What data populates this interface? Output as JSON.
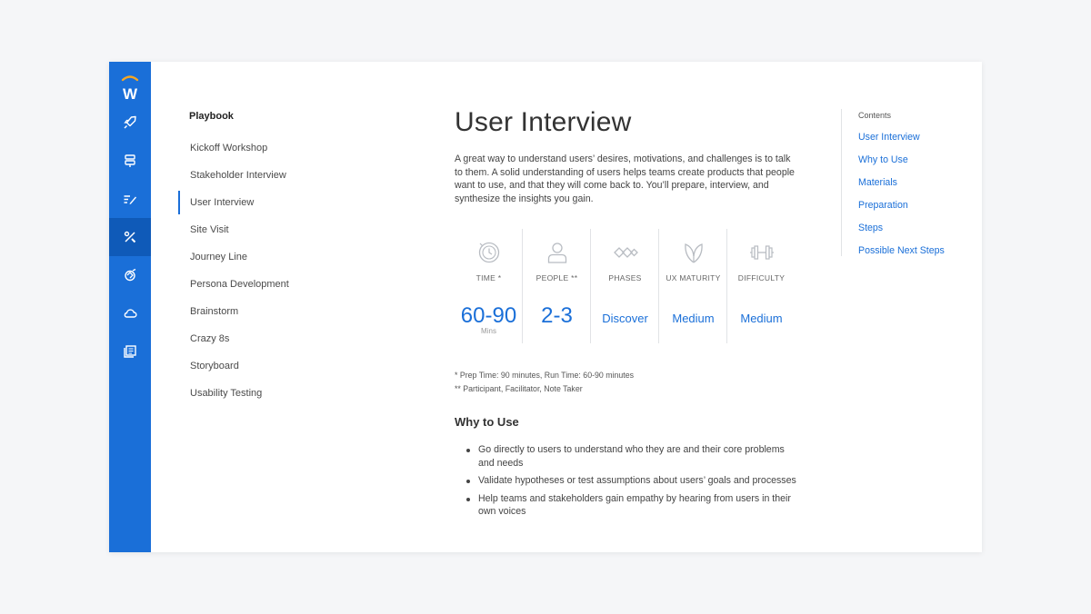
{
  "playbook": {
    "title": "Playbook",
    "items": [
      {
        "label": "Kickoff Workshop"
      },
      {
        "label": "Stakeholder Interview"
      },
      {
        "label": "User Interview"
      },
      {
        "label": "Site Visit"
      },
      {
        "label": "Journey Line"
      },
      {
        "label": "Persona Development"
      },
      {
        "label": "Brainstorm"
      },
      {
        "label": "Crazy 8s"
      },
      {
        "label": "Storyboard"
      },
      {
        "label": "Usability Testing"
      }
    ],
    "active_item": "User Interview"
  },
  "rail": {
    "logo_letter": "W",
    "icons": [
      "rocket-icon",
      "signpost-icon",
      "edit-list-icon",
      "tools-icon",
      "handshake-icon",
      "cloud-icon",
      "library-icon"
    ],
    "active_icon": "tools-icon"
  },
  "main": {
    "title": "User Interview",
    "intro": "A great way to understand users’ desires, motivations, and challenges is to talk to them. A solid understanding of users helps teams create products that people want to use, and that they will come back to. You’ll prepare, interview, and synthesize the insights you gain.",
    "stats": [
      {
        "icon": "clock-icon",
        "label": "TIME *",
        "value": "60-90",
        "unit": "Mins"
      },
      {
        "icon": "person-icon",
        "label": "PEOPLE **",
        "value": "2-3",
        "unit": ""
      },
      {
        "icon": "phases-icon",
        "label": "PHASES",
        "value": "Discover",
        "unit": ""
      },
      {
        "icon": "leaf-icon",
        "label": "UX MATURITY",
        "value": "Medium",
        "unit": ""
      },
      {
        "icon": "dumbbell-icon",
        "label": "DIFFICULTY",
        "value": "Medium",
        "unit": ""
      }
    ],
    "footnotes": [
      "* Prep Time: 90 minutes, Run Time: 60-90 minutes",
      "** Participant, Facilitator, Note Taker"
    ],
    "why_title": "Why to Use",
    "why_items": [
      "Go directly to users to understand who they are and their core problems and needs",
      "Validate hypotheses or test assumptions about users’ goals and processes",
      "Help teams and stakeholders gain empathy by hearing from users in their own voices"
    ]
  },
  "toc": {
    "title": "Contents",
    "links": [
      "User Interview",
      "Why to Use",
      "Materials",
      "Preparation",
      "Steps",
      "Possible Next Steps"
    ]
  },
  "colors": {
    "brand_blue": "#1a6fd8",
    "rail_active": "#0f5ab8",
    "logo_arc": "#f5a623"
  }
}
